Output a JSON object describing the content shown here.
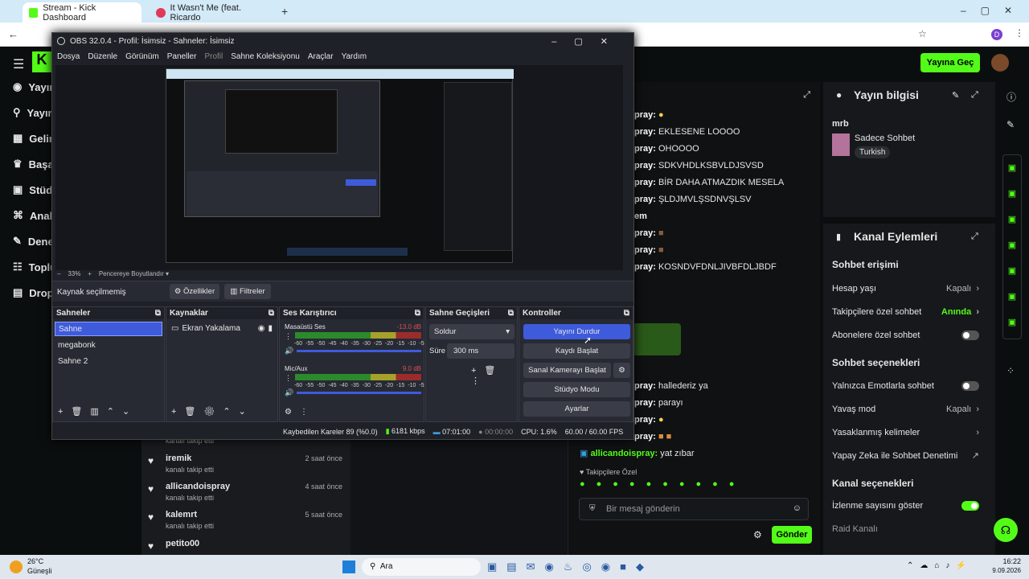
{
  "browser": {
    "tabs": [
      {
        "label": "Stream - Kick Dashboard"
      },
      {
        "label": "It Wasn't Me (feat. Ricardo"
      }
    ]
  },
  "kick": {
    "sidebar": [
      "Yayın",
      "Yayın",
      "Gelir",
      "Başar",
      "Stüdy",
      "Anali",
      "Dene",
      "Toplu",
      "Dropl"
    ],
    "go_live": "Yayına Geç",
    "chat_lines": [
      {
        "user": "pray:",
        "text": ""
      },
      {
        "user": "pray:",
        "text": "EKLESENE LOOOO"
      },
      {
        "user": "pray:",
        "text": "OHOOOO"
      },
      {
        "user": "pray:",
        "text": "SDKVHDLKSBVLDJSVSD"
      },
      {
        "user": "pray:",
        "text": "BİR DAHA ATMAZDIK MESELA"
      },
      {
        "user": "pray:",
        "text": "ŞLDJMVLŞSDNVŞLSV"
      },
      {
        "user": "em",
        "text": ""
      },
      {
        "user": "pray:",
        "text": ""
      },
      {
        "user": "pray:",
        "text": ""
      },
      {
        "user": "pray:",
        "text": "KOSNDVFDNLJIVBFDLJBDF"
      }
    ],
    "chat_lower": [
      {
        "user": "pray:",
        "text": "hallederiz ya"
      },
      {
        "user": "pray:",
        "text": "parayı"
      },
      {
        "user": "pray:",
        "text": ""
      },
      {
        "user": "pray:",
        "text": ""
      },
      {
        "user": "allicandoispray:",
        "text": "yat zıbar"
      }
    ],
    "followers_only": "Takipçilere Özel",
    "chat_placeholder": "Bir mesaj gönderin",
    "send": "Gönder",
    "activity": [
      {
        "name": "iremik",
        "action": "kanalı takip etti",
        "time": "2 saat önce"
      },
      {
        "name": "allicandoispray",
        "action": "kanalı takip etti",
        "time": "4 saat önce"
      },
      {
        "name": "kalemrt",
        "action": "kanalı takip etti",
        "time": "5 saat önce"
      },
      {
        "name": "petito00",
        "action": "",
        "time": "5 saat önce"
      }
    ],
    "activity_top": "kanalı takip etti",
    "stream_info": {
      "title": "Yayın bilgisi",
      "user": "mrb",
      "category": "Sadece Sohbet",
      "tag": "Turkish"
    },
    "channel_actions": {
      "title": "Kanal Eylemleri",
      "chat_access": "Sohbet erişimi",
      "rows1": [
        {
          "label": "Hesap yaşı",
          "value": "Kapalı",
          "kind": "chevron"
        },
        {
          "label": "Takipçilere özel sohbet",
          "value": "Anında",
          "kind": "chevron-green"
        },
        {
          "label": "Abonelere özel sohbet",
          "value": "",
          "kind": "toggle-off"
        }
      ],
      "chat_options": "Sohbet seçenekleri",
      "rows2": [
        {
          "label": "Yalnızca Emotlarla sohbet",
          "value": "",
          "kind": "toggle-off"
        },
        {
          "label": "Yavaş mod",
          "value": "Kapalı",
          "kind": "chevron"
        },
        {
          "label": "Yasaklanmış kelimeler",
          "value": "",
          "kind": "chevron"
        },
        {
          "label": "Yapay Zeka ile Sohbet Denetimi",
          "value": "",
          "kind": "external"
        }
      ],
      "channel_options": "Kanal seçenekleri",
      "rows3": [
        {
          "label": "İzlenme sayısını göster",
          "value": "",
          "kind": "toggle-on"
        },
        {
          "label": "Raid Kanalı",
          "value": "",
          "kind": "none"
        }
      ]
    }
  },
  "obs": {
    "title": "OBS 32.0.4 - Profil: İsimsiz - Sahneler: İsimsiz",
    "menu": [
      "Dosya",
      "Düzenle",
      "Görünüm",
      "Paneller",
      "Profil",
      "Sahne Koleksiyonu",
      "Araçlar",
      "Yardım"
    ],
    "zoom": "33%",
    "fit_label": "Pencereye Boyutlandır",
    "no_source": "Kaynak seçilmemiş",
    "properties": "Özellikler",
    "filters": "Filtreler",
    "scenes_title": "Sahneler",
    "scenes": [
      "Sahne",
      "megabonk",
      "Sahne 2"
    ],
    "sources_title": "Kaynaklar",
    "sources": [
      "Ekran Yakalama"
    ],
    "mixer_title": "Ses Karıştırıcı",
    "mixer": [
      {
        "name": "Masaüstü Ses",
        "db": "-13.0 dB"
      },
      {
        "name": "Mic/Aux",
        "db": "9.0 dB"
      }
    ],
    "ticks": [
      "-60",
      "-55",
      "-50",
      "-45",
      "-40",
      "-35",
      "-30",
      "-25",
      "-20",
      "-15",
      "-10",
      "-5",
      "0"
    ],
    "transitions_title": "Sahne Geçişleri",
    "transition": "Soldur",
    "duration_label": "Süre",
    "duration": "300 ms",
    "controls_title": "Kontroller",
    "controls": [
      "Yayını Durdur",
      "Kaydı Başlat",
      "Sanal Kamerayı Başlat",
      "Stüdyo Modu",
      "Ayarlar"
    ],
    "status": {
      "dropped": "Kaybedilen Kareler 89 (%0.0)",
      "kbps": "6181 kbps",
      "live_time": "07:01:00",
      "rec_time": "00:00:00",
      "cpu": "CPU: 1.6%",
      "fps": "60.00 / 60.00 FPS"
    }
  },
  "taskbar": {
    "weather_temp": "26°C",
    "weather_text": "Güneşli",
    "search": "Ara",
    "time": "16:22",
    "date": "9.09.2026"
  },
  "colors": {
    "kick_green": "#53fc18",
    "obs_blue": "#3e5bdc"
  }
}
